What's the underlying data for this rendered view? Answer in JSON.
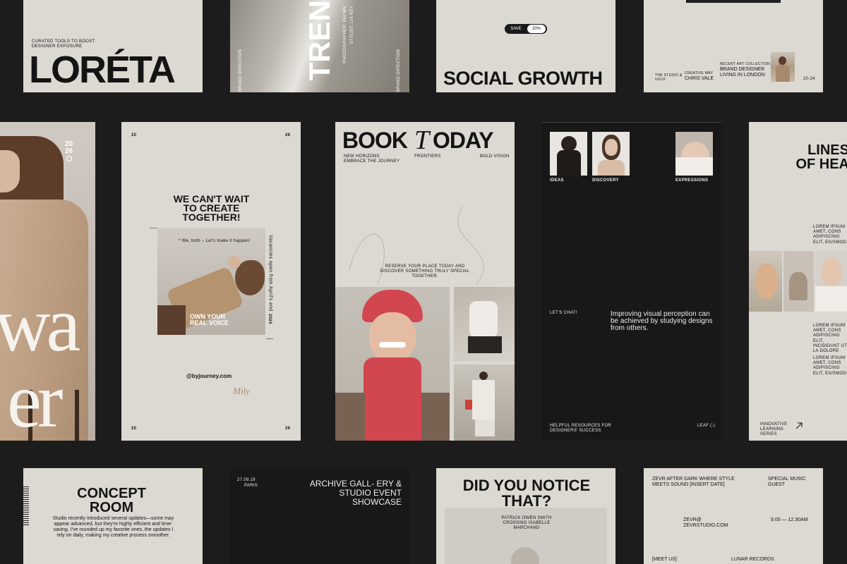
{
  "colors": {
    "background": "#1c1c1c",
    "card_light": "#dcd9d3",
    "card_dark": "#181818",
    "accent_red": "#d2464f"
  },
  "loreta": {
    "tagline": "CURATED TOOLS TO BOOST DESIGNER EXPOSURE",
    "title": "LORÉTA"
  },
  "trend": {
    "title": "TREN",
    "credit1": "PHOTOGRAPHER: KAI WU",
    "credit2": "STYLIST: LIA REY",
    "side": "BRAND DIRECTION",
    "side2": "BRAND DIRECTION"
  },
  "social": {
    "save_label": "SAVE",
    "save_value": "20%",
    "title": "SOCIAL GROWTH"
  },
  "brand_card": {
    "studio": "THE STUDIO & UI/UX",
    "creative_way_label": "CREATIVE WAY",
    "name": "CHRIS VALE",
    "collection_label": "RECENT ART COLLECTION",
    "headline": "BRAND DESIGNER LIVING IN LONDON",
    "years": "20-24"
  },
  "wa": {
    "year_top": "20",
    "year_bottom": "26",
    "big1": "wa",
    "big2": "er"
  },
  "cant_wait": {
    "num_tl": "20",
    "num_tr": "26",
    "num_bl": "20",
    "num_br": "26",
    "headline": "WE CAN'T WAIT TO CREATE TOGETHER!",
    "sub": "* We, both – Let's make it happen!",
    "photo_caption": "OWN YOUR REAL VOICE",
    "side_text": "Vacancies open from April's end",
    "side_year": "2024",
    "handle": "@byjourney.com",
    "signature": "Mily"
  },
  "book": {
    "title_a": "BOOK",
    "title_t": "T",
    "title_b": "ODAY",
    "col1": "NEW HORIZONS EMBRACE THE JOURNEY",
    "col2": "FRONTIERS",
    "col3": "BOLD VISION",
    "body": "RESERVE YOUR PLACE TODAY AND DISCOVER SOMETHING TRULY SPECIAL TOGETHER."
  },
  "ideas": {
    "label1": "IDEAS",
    "label2": "DISCOVERY",
    "label3": "EXPRESSIONS",
    "chat": "LET'S CHAT!",
    "quote": "Improving visual perception can be achieved by studying designs from others.",
    "footer_left": "HELPFUL RESOURCES FOR DESIGNERS' SUCCESS",
    "footer_right": "LEAF (-)"
  },
  "lines": {
    "title": "LINES OF HEA",
    "lorem1": "LOREM IPSUM AMET, CONS ADIPISCING ELIT, EIUSMOD",
    "lorem2": "LOREM IPSUM AMET, CONS ADIPISCING ELIT, INCIDIDUNT UT LA DOLORE",
    "lorem3": "LOREM IPSUM AMET, CONS ADIPISCING ELIT, EIUSMOD",
    "footer": "INNOVATIVE LEARNING SERIES"
  },
  "concept": {
    "title": "CONCEPT ROOM",
    "body": "Studio recently introduced several updates—some may appear advanced, but they're highly efficient and time-saving. I've rounded up my favorite ones, the updates I rely on daily, making my creative process smoother."
  },
  "archive": {
    "date": "27.09.19",
    "city": "PARIS",
    "title": "ARCHIVE GALL- ERY & STUDIO EVENT SHOWCASE"
  },
  "notice": {
    "title": "DID YOU NOTICE THAT?",
    "names": "PATRICK OWEN SMITH CROSSING ISABELLE MARCHAND"
  },
  "zevr": {
    "headline": "ZEVR AFTER DARK WHERE STYLE MEETS SOUND [INSERT DATE]",
    "special": "SPECIAL MUSIC GUEST",
    "contact": "ZEVR@ ZEVRSTUDIO.COM",
    "time": "9.00 — 12.30AM",
    "meet": "[MEET US]",
    "records": "LUNAR RECORDS"
  }
}
